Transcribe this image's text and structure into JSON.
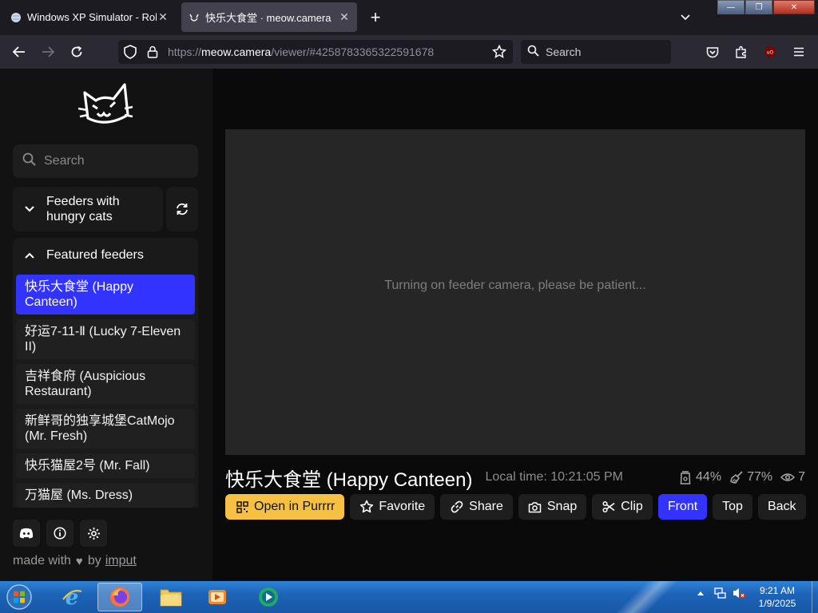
{
  "browser": {
    "tabs": [
      {
        "title": "Windows XP Simulator - Roblox",
        "active": false
      },
      {
        "title": "快乐大食堂 · meow.camera",
        "active": true
      }
    ],
    "url": {
      "scheme": "https://",
      "host": "meow.camera",
      "path": "/viewer/#4258783365322591678"
    },
    "search_placeholder": "Search"
  },
  "sidebar": {
    "search_placeholder": "Search",
    "groups": {
      "hungry": "Feeders with hungry cats",
      "featured": "Featured feeders"
    },
    "feeders": [
      {
        "label": "快乐大食堂 (Happy Canteen)",
        "active": true
      },
      {
        "label": "好运7-11-Ⅱ (Lucky 7-Eleven II)",
        "active": false
      },
      {
        "label": "吉祥食府 (Auspicious Restaurant)",
        "active": false
      },
      {
        "label": "新鲜哥的独享城堡CatMojo (Mr. Fresh)",
        "active": false
      },
      {
        "label": "快乐猫屋2号 (Mr. Fall)",
        "active": false
      },
      {
        "label": "万猫屋 (Ms. Dress)",
        "active": false
      }
    ],
    "footer": {
      "made_with": "made with",
      "by": "by",
      "author": "imput"
    }
  },
  "viewer": {
    "loading_message": "Turning on feeder camera, please be patient...",
    "title": "快乐大食堂 (Happy Canteen)",
    "local_time": "Local time: 10:21:05 PM",
    "stats": {
      "food": "44%",
      "battery": "77%",
      "viewers": "7"
    },
    "actions": {
      "open": "Open in Purrrr",
      "favorite": "Favorite",
      "share": "Share",
      "snap": "Snap",
      "clip": "Clip",
      "front": "Front",
      "top": "Top",
      "back": "Back"
    }
  },
  "taskbar": {
    "time": "9:21 AM",
    "date": "1/9/2025"
  },
  "colors": {
    "accent": "#3333ff",
    "open_button": "#f6c143",
    "panel": "#1a1a1a",
    "video_bg": "#262626"
  }
}
